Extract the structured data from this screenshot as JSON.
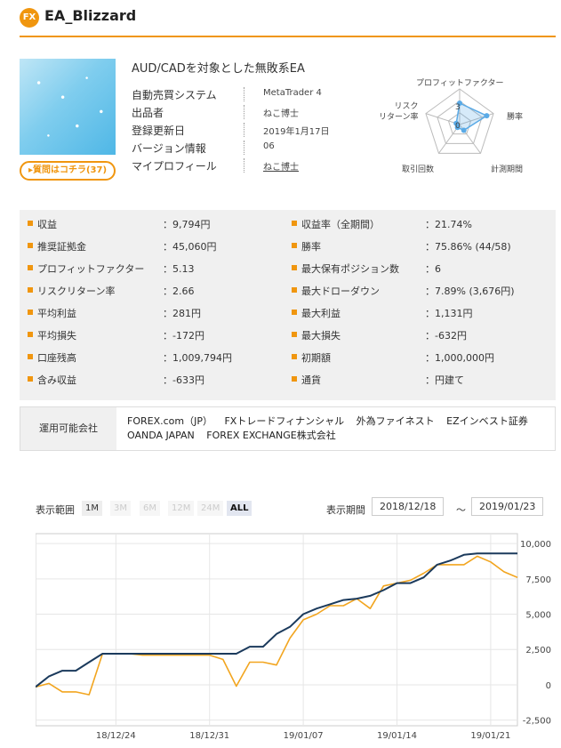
{
  "header": {
    "badge": "FX",
    "title": "EA_Blizzard"
  },
  "ea": {
    "description": "AUD/CADを対象とした無敗系EA",
    "question_button": "▸質問はコチラ(37)",
    "info": [
      {
        "key": "自動売買システム",
        "value": "MetaTrader 4"
      },
      {
        "key": "出品者",
        "value": "ねこ博士"
      },
      {
        "key": "登録更新日",
        "value": "2019年1月17日"
      },
      {
        "key": "バージョン情報",
        "value": "06"
      },
      {
        "key": "マイプロフィール",
        "value": "ねこ博士"
      }
    ]
  },
  "radar": {
    "labels": {
      "top": "プロフィットファクター",
      "right": "勝率",
      "left": "リスク\nリターン率",
      "bottom_left": "取引回数",
      "bottom_right": "計測期間"
    },
    "scale_labels": [
      "3",
      "0"
    ],
    "values": {
      "top": 3,
      "right": 4,
      "bottom_right": 1,
      "bottom_left": 0.5,
      "left": 0.5
    }
  },
  "stats": [
    {
      "key": "収益",
      "value": "：9,794円"
    },
    {
      "key": "推奨証拠金",
      "value": "：45,060円"
    },
    {
      "key": "プロフィットファクター",
      "value": "：5.13"
    },
    {
      "key": "リスクリターン率",
      "value": "：2.66"
    },
    {
      "key": "平均利益",
      "value": "：281円"
    },
    {
      "key": "平均損失",
      "value": "：-172円"
    },
    {
      "key": "口座残高",
      "value": "：1,009,794円"
    },
    {
      "key": "含み収益",
      "value": "：-633円"
    },
    {
      "key": "収益率（全期間）",
      "value": "：21.74%"
    },
    {
      "key": "勝率",
      "value": "：75.86% (44/58)"
    },
    {
      "key": "最大保有ポジション数",
      "value": "：6"
    },
    {
      "key": "最大ドローダウン",
      "value": "：7.89% (3,676円)"
    },
    {
      "key": "最大利益",
      "value": "：1,131円"
    },
    {
      "key": "最大損失",
      "value": "：-632円"
    },
    {
      "key": "初期額",
      "value": "：1,000,000円"
    },
    {
      "key": "通貨",
      "value": "：円建て"
    }
  ],
  "companies": {
    "label": "運用可能会社",
    "row1": [
      "FOREX.com（JP）",
      "FXトレードフィナンシャル",
      "外為ファイネスト",
      "EZインベスト証券"
    ],
    "row2": [
      "OANDA JAPAN",
      "FOREX EXCHANGE株式会社"
    ]
  },
  "chart_controls": {
    "range_label": "表示範囲",
    "ranges": [
      "1M",
      "3M",
      "6M",
      "12M",
      "24M",
      "ALL"
    ],
    "active_ranges": [
      "1M",
      "ALL"
    ],
    "selected": "ALL",
    "period_label": "表示期間",
    "from": "2018/12/18",
    "tilde": "～",
    "to": "2019/01/23"
  },
  "chart_data": {
    "type": "line",
    "x_ticks": [
      "18/12/24",
      "18/12/31",
      "19/01/07",
      "19/01/14",
      "19/01/21"
    ],
    "y_ticks": [
      "10,000",
      "7,500",
      "5,000",
      "2,500",
      "0",
      "-2,500"
    ],
    "ylim": [
      -2500,
      10000
    ],
    "x": [
      "2018-12-18",
      "2018-12-19",
      "2018-12-20",
      "2018-12-21",
      "2018-12-22",
      "2018-12-23",
      "2018-12-24",
      "2018-12-25",
      "2018-12-26",
      "2018-12-27",
      "2018-12-28",
      "2018-12-29",
      "2018-12-30",
      "2018-12-31",
      "2019-01-01",
      "2019-01-02",
      "2019-01-03",
      "2019-01-04",
      "2019-01-05",
      "2019-01-06",
      "2019-01-07",
      "2019-01-08",
      "2019-01-09",
      "2019-01-10",
      "2019-01-11",
      "2019-01-12",
      "2019-01-13",
      "2019-01-14",
      "2019-01-15",
      "2019-01-16",
      "2019-01-17",
      "2019-01-18",
      "2019-01-19",
      "2019-01-20",
      "2019-01-21",
      "2019-01-22",
      "2019-01-23"
    ],
    "series": [
      {
        "color": "#1b3a5c",
        "values": [
          -150,
          600,
          1000,
          1000,
          1600,
          2200,
          2200,
          2200,
          2200,
          2200,
          2200,
          2200,
          2200,
          2200,
          2200,
          2200,
          2700,
          2700,
          3600,
          4100,
          5000,
          5400,
          5700,
          6000,
          6100,
          6300,
          6700,
          7200,
          7200,
          7600,
          8500,
          8800,
          9200,
          9300,
          9300,
          9300,
          9300
        ]
      },
      {
        "color": "#f2a51f",
        "values": [
          -150,
          100,
          -500,
          -500,
          -700,
          2200,
          2200,
          2200,
          2100,
          2100,
          2100,
          2100,
          2100,
          2100,
          1800,
          -100,
          1600,
          1600,
          1400,
          3300,
          4600,
          5000,
          5600,
          5600,
          6100,
          5400,
          7000,
          7200,
          7400,
          7900,
          8500,
          8500,
          8500,
          9100,
          8700,
          8000,
          7600
        ]
      }
    ]
  },
  "colors": {
    "accent": "#f0960f",
    "navy": "#1b3a5c",
    "orange_line": "#f2a51f"
  }
}
